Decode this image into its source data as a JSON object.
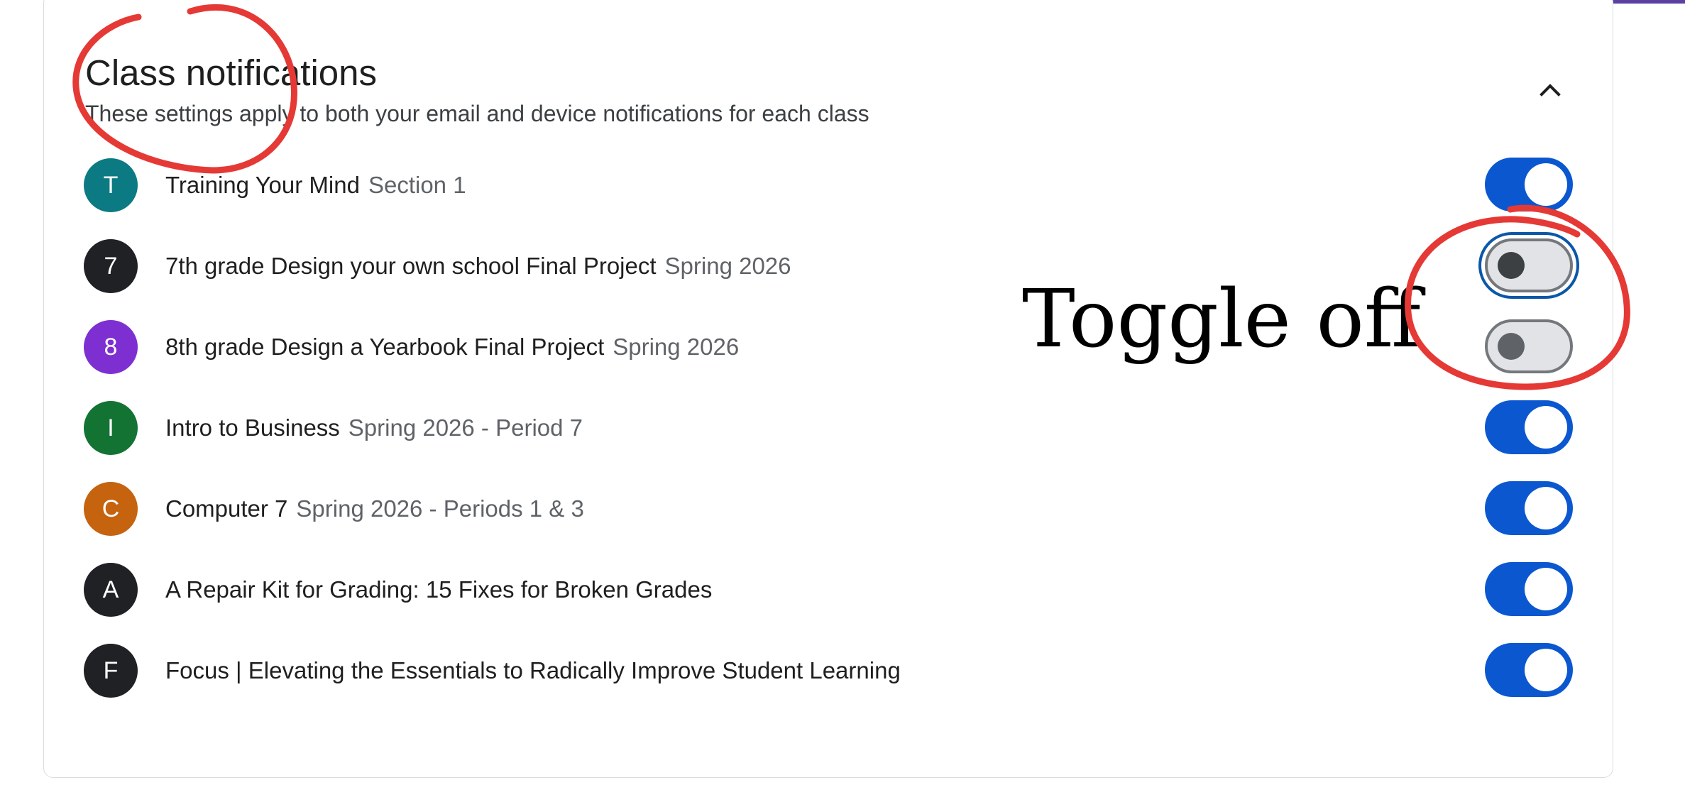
{
  "header": {
    "title": "Class notifications",
    "subtitle": "These settings apply to both your email and device notifications for each class"
  },
  "classes": [
    {
      "initial": "T",
      "name": "Training Your Mind",
      "section": "Section 1",
      "color": "#0b7a82",
      "enabled": true,
      "focused": false
    },
    {
      "initial": "7",
      "name": "7th grade Design your own school Final Project",
      "section": "Spring 2026",
      "color": "#202124",
      "enabled": false,
      "focused": true
    },
    {
      "initial": "8",
      "name": "8th grade Design a Yearbook Final Project",
      "section": "Spring 2026",
      "color": "#7e2fd1",
      "enabled": false,
      "focused": false
    },
    {
      "initial": "I",
      "name": "Intro to Business",
      "section": "Spring 2026 - Period 7",
      "color": "#137333",
      "enabled": true,
      "focused": false
    },
    {
      "initial": "C",
      "name": "Computer 7",
      "section": "Spring 2026 - Periods 1 & 3",
      "color": "#c5630f",
      "enabled": true,
      "focused": false
    },
    {
      "initial": "A",
      "name": "A Repair Kit for Grading: 15 Fixes for Broken Grades",
      "section": "",
      "color": "#202124",
      "enabled": true,
      "focused": false
    },
    {
      "initial": "F",
      "name": "Focus | Elevating the Essentials to Radically Improve Student Learning",
      "section": "",
      "color": "#202124",
      "enabled": true,
      "focused": false
    }
  ],
  "annotation": {
    "text": "Toggle off",
    "color": "#e53935"
  },
  "icons": {
    "collapse": "chevron-up-icon"
  },
  "colors": {
    "toggle_on": "#0b57d0",
    "toggle_off_track": "#e1e3e6",
    "top_accent": "#5b3fa3"
  }
}
